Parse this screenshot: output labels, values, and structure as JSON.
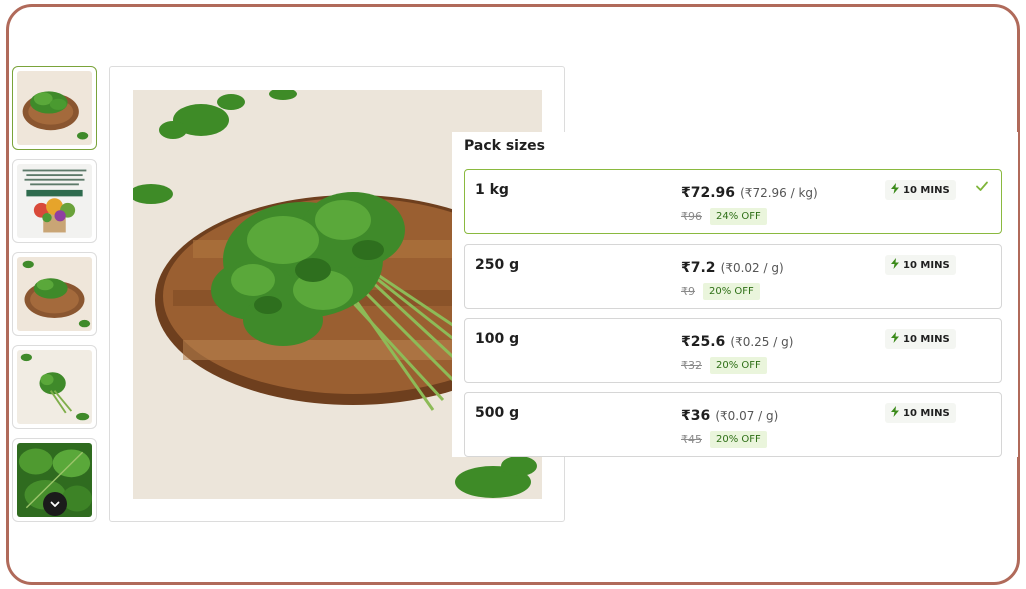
{
  "pack_sizes": {
    "title": "Pack sizes",
    "options": [
      {
        "size": "1 kg",
        "price": "₹72.96",
        "unit_price": "(₹72.96 / kg)",
        "mrp": "₹96",
        "discount": "24% OFF",
        "delivery": "10 MINS",
        "selected": true
      },
      {
        "size": "250 g",
        "price": "₹7.2",
        "unit_price": "(₹0.02 / g)",
        "mrp": "₹9",
        "discount": "20% OFF",
        "delivery": "10 MINS",
        "selected": false
      },
      {
        "size": "100 g",
        "price": "₹25.6",
        "unit_price": "(₹0.25 / g)",
        "mrp": "₹32",
        "discount": "20% OFF",
        "delivery": "10 MINS",
        "selected": false
      },
      {
        "size": "500 g",
        "price": "₹36",
        "unit_price": "(₹0.07 / g)",
        "mrp": "₹45",
        "discount": "20% OFF",
        "delivery": "10 MINS",
        "selected": false
      }
    ]
  },
  "icons": {
    "delivery": "lightning-icon",
    "selected": "checkmark-icon",
    "thumbnail_scroll": "chevron-down-icon"
  },
  "colors": {
    "frame_border": "#b06a5a",
    "selected_border": "#8ab93f",
    "discount_text": "#2e6f16",
    "discount_bg": "#eaf5dc",
    "lightning": "#3b8a1a"
  }
}
